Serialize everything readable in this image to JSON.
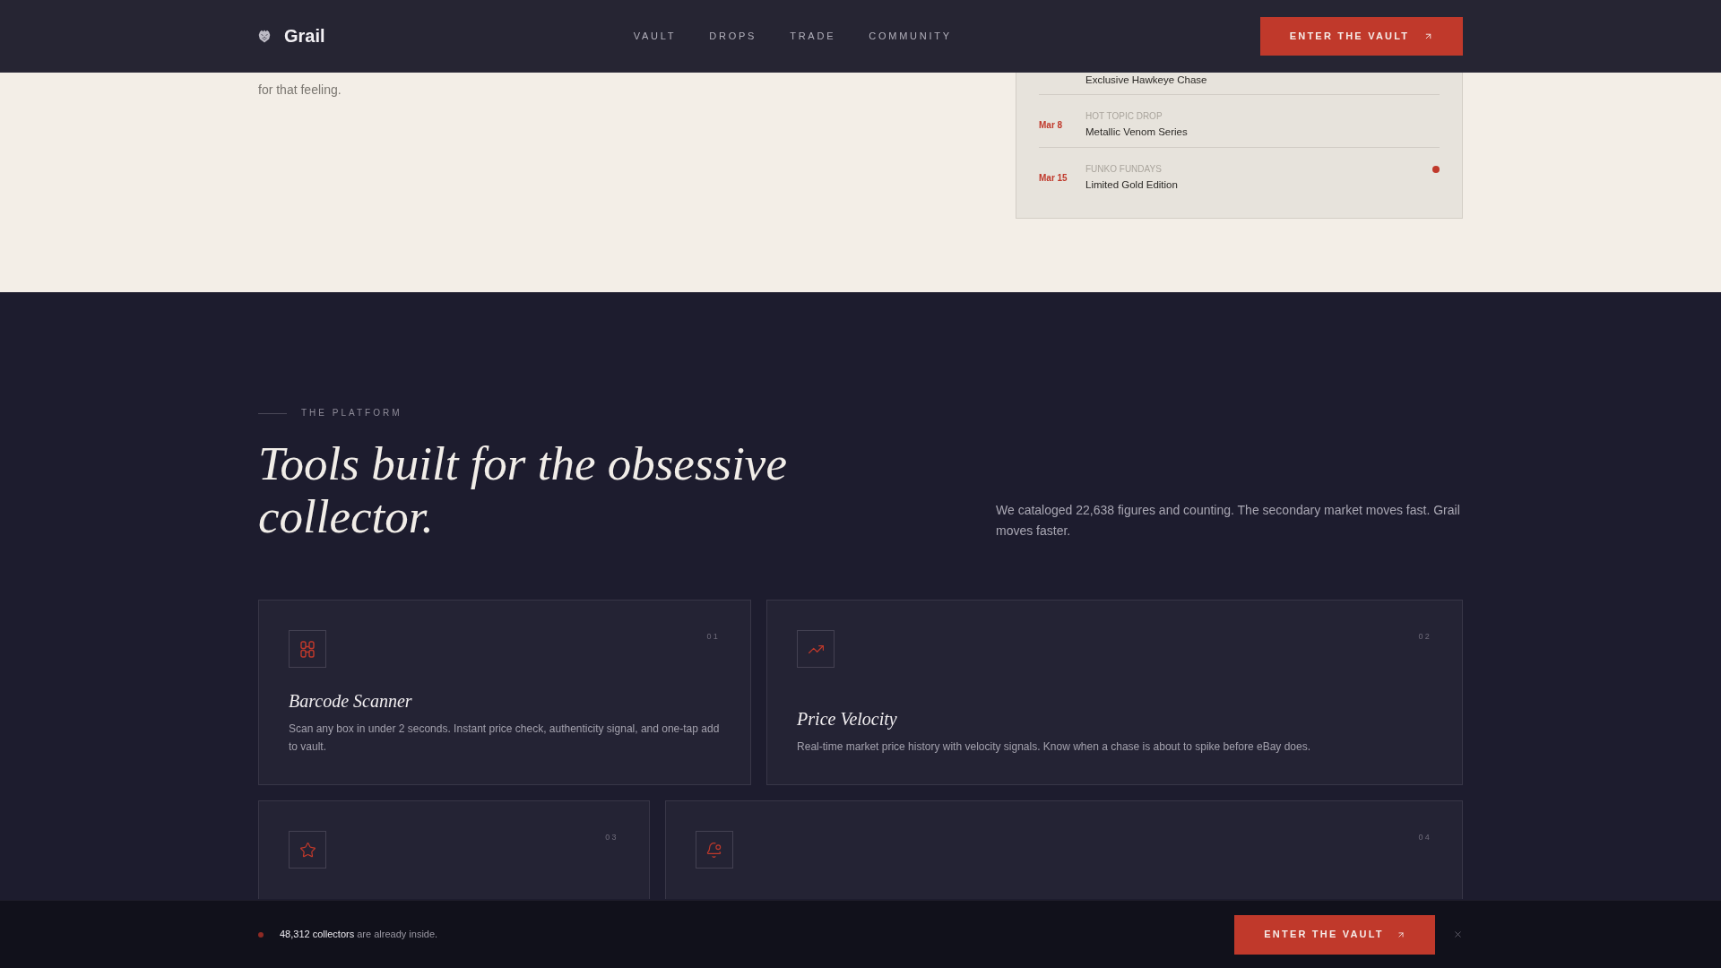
{
  "nav": {
    "brand": "Grail",
    "links": [
      "VAULT",
      "DROPS",
      "TRADE",
      "COMMUNITY"
    ],
    "cta": "ENTER THE VAULT"
  },
  "intro": {
    "paragraph": "for that feeling."
  },
  "drops": [
    {
      "title": "Exclusive Hawkeye Chase",
      "active": false
    },
    {
      "date": "Mar 8",
      "category": "HOT TOPIC DROP",
      "title": "Metallic Venom Series",
      "active": false
    },
    {
      "date": "Mar 15",
      "category": "FUNKO FUNDAYS",
      "title": "Limited Gold Edition",
      "active": true
    }
  ],
  "platform": {
    "eyebrow": "THE PLATFORM",
    "heading": "Tools built for the obsessive collector.",
    "blurb": "We cataloged 22,638 figures and counting. The secondary market moves fast. Grail moves faster."
  },
  "features": [
    {
      "number": "01",
      "title": "Barcode Scanner",
      "description": "Scan any box in under 2 seconds. Instant price check, authenticity signal, and one-tap add to vault."
    },
    {
      "number": "02",
      "title": "Price Velocity",
      "description": "Real-time market price history with velocity signals. Know when a chase is about to spike before eBay does."
    },
    {
      "number": "03"
    },
    {
      "number": "04"
    }
  ],
  "banner": {
    "text": "**48,312 collectors** are already inside.",
    "cta": "ENTER THE VAULT"
  }
}
